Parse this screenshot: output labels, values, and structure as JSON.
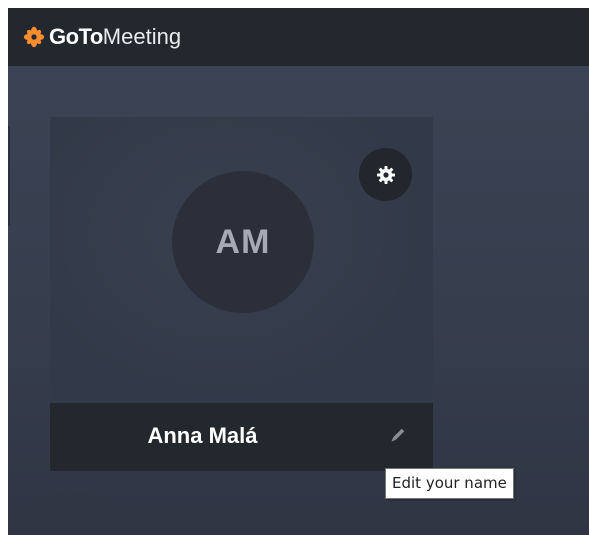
{
  "app": {
    "logo_bold": "GoTo",
    "logo_light": "Meeting",
    "brand_color": "#f68d2e"
  },
  "participant": {
    "initials": "AM",
    "name": "Anna Malá"
  },
  "icons": {
    "logo": "goto-flower-icon",
    "settings": "gear-icon",
    "edit": "pencil-icon"
  },
  "tooltip": {
    "text": "Edit your name"
  }
}
